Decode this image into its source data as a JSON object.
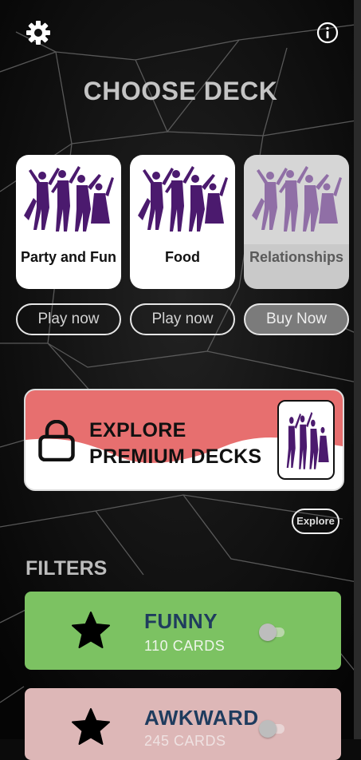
{
  "header": {
    "title": "CHOOSE DECK",
    "settings_icon": "gear-icon",
    "info_icon": "info-icon"
  },
  "decks": [
    {
      "name": "Party and Fun",
      "button": "Play now",
      "locked": false
    },
    {
      "name": "Food",
      "button": "Play now",
      "locked": false
    },
    {
      "name": "Relationships",
      "button": "Buy Now",
      "locked": true
    }
  ],
  "premium": {
    "line1": "EXPLORE",
    "line2": "PREMIUM DECKS",
    "explore_label": "Explore",
    "colors": {
      "wave": "#e76f6f"
    }
  },
  "filters": {
    "heading": "FILTERS",
    "items": [
      {
        "name": "FUNNY",
        "count": "110 CARDS",
        "enabled": false,
        "color": "#7cc262"
      },
      {
        "name": "AWKWARD",
        "count": "245 CARDS",
        "enabled": false,
        "color": "#ddb7b7"
      }
    ]
  },
  "colors": {
    "accent_purple": "#4b1a6e",
    "title_gray": "#c4c4c4"
  }
}
